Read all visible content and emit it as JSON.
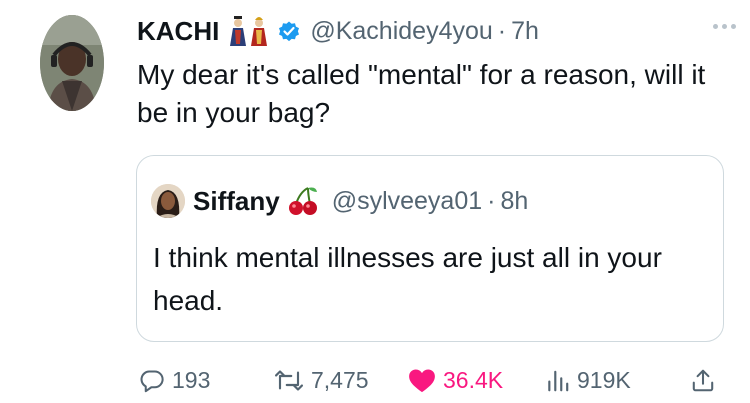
{
  "tweet": {
    "author_name": "KACHI",
    "author_handle": "@Kachidey4you",
    "separator": "·",
    "time": "7h",
    "text": "My dear it's called \"mental\" for a reason, will it be in your bag?"
  },
  "quoted_tweet": {
    "author_name": "Siffany",
    "author_handle": "@sylveeya01",
    "separator": "·",
    "time": "8h",
    "text": "I think mental illnesses are just all in your head."
  },
  "actions": {
    "replies": "193",
    "reposts": "7,475",
    "likes": "36.4K",
    "views": "919K"
  },
  "icons": {
    "reply": "speech-bubble-icon",
    "repost": "retweet-arrows-icon",
    "like": "heart-icon",
    "views": "bar-chart-icon",
    "share": "upload-share-icon",
    "verified": "verified-badge-icon",
    "name_emoji": "people-figures-emoji",
    "quoted_name_emoji": "cherries-emoji",
    "more": "more-dots-icon"
  },
  "colors": {
    "text": "#0f1419",
    "muted": "#536471",
    "verified_blue": "#1d9bf0",
    "like_pink": "#f91880",
    "border": "#cfd9de"
  }
}
